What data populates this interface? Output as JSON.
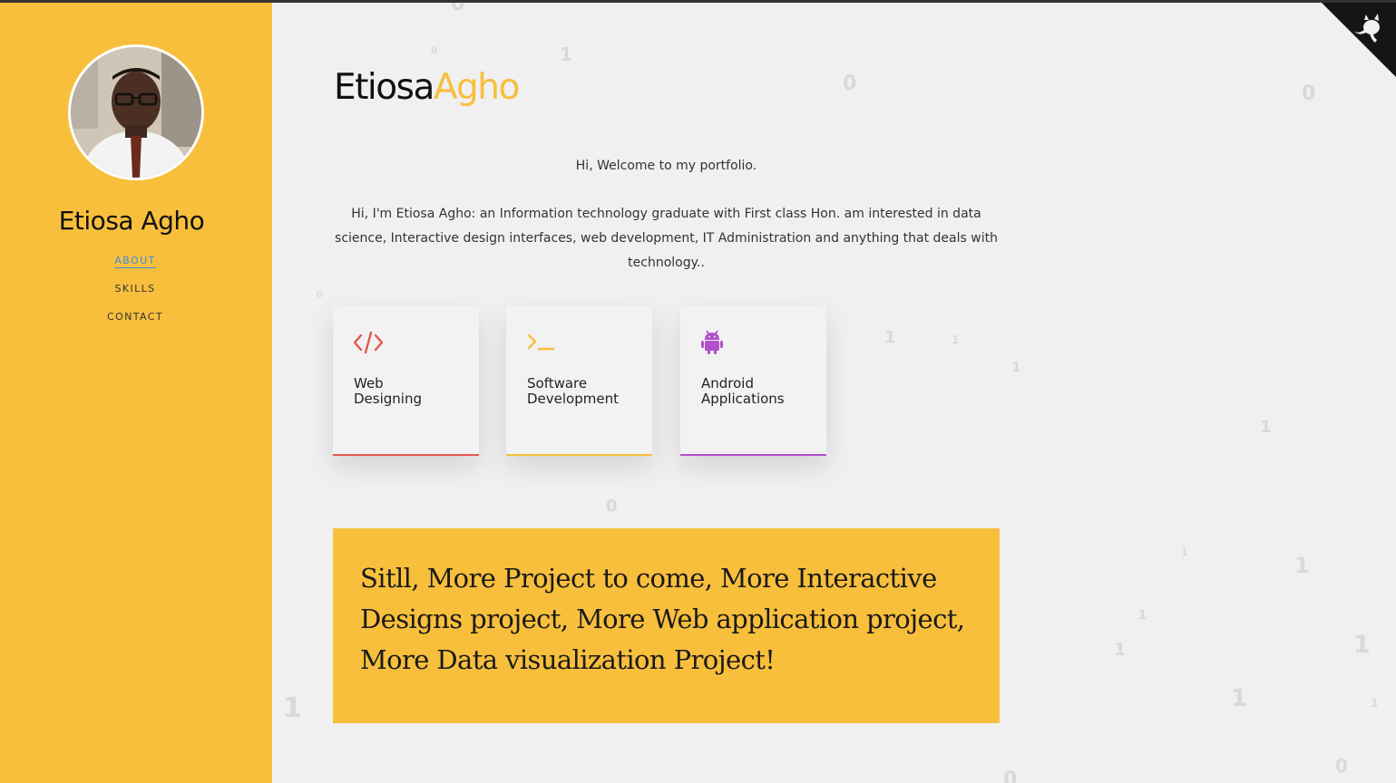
{
  "sidebar": {
    "name": "Etiosa Agho",
    "nav": [
      {
        "label": "ABOUT",
        "active": true
      },
      {
        "label": "SKILLS",
        "active": false
      },
      {
        "label": "CONTACT",
        "active": false
      }
    ]
  },
  "header": {
    "first_name": "Etiosa",
    "last_name": "Agho"
  },
  "main": {
    "welcome": "Hi, Welcome to my portfolio.",
    "intro": "Hi, I'm Etiosa Agho: an Information technology graduate with First class Hon. am interested in data science, Interactive design interfaces, web development, IT Administration and anything that deals with technology..",
    "cards": [
      {
        "icon": "code-icon",
        "label_line1": "Web",
        "label_line2": "Designing",
        "color": "#e05a4f"
      },
      {
        "icon": "terminal-icon",
        "label_line1": "Software",
        "label_line2": "Development",
        "color": "#f8bf3c"
      },
      {
        "icon": "android-icon",
        "label_line1": "Android",
        "label_line2": "Applications",
        "color": "#b24fc9"
      }
    ],
    "banner": "Sitll, More Project to come, More Interactive Designs project, More Web application project, More Data visualization Project!"
  },
  "colors": {
    "accent": "#f8bf3c",
    "background": "#f0f0f0",
    "active_link": "#3a8fd9"
  },
  "corner": {
    "icon": "github-octocat-icon"
  },
  "background_digits": [
    "0",
    "1",
    "0",
    "0",
    "0",
    "1",
    "1",
    "1",
    "1",
    "1",
    "1",
    "1",
    "1",
    "1",
    "1",
    "1",
    "1",
    "0",
    "0",
    "0",
    "0"
  ]
}
